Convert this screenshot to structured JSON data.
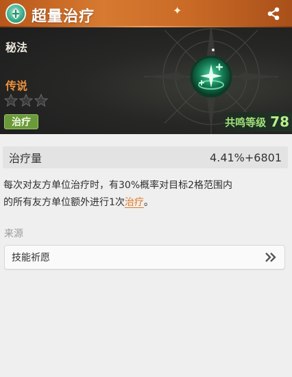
{
  "header": {
    "title": "超量治疗",
    "icon": "heal-emblem-icon",
    "share_icon": "share-icon",
    "accent": "#c96a26"
  },
  "banner": {
    "category": "秘法",
    "rarity": "传说",
    "rarity_color": "#f0913a",
    "stars_total": 3,
    "stars_filled": 0,
    "type_tag": "治疗",
    "type_tag_color": "#6a9a3a",
    "skill_icon": "healing-sparkle-orb-icon",
    "resonance_label": "共鸣等级",
    "resonance_value": "78",
    "resonance_color": "#9fe27a"
  },
  "stat": {
    "label": "治疗量",
    "value": "4.41%+6801"
  },
  "description": {
    "line1": "每次对友方单位治疗时，有30%概率对目标2格范围内",
    "line2_prefix": "的所有友方单位额外进行1次",
    "keyword": "治疗",
    "line2_suffix": "。",
    "keyword_color": "#e07820"
  },
  "source": {
    "label": "来源",
    "item": "技能祈愿",
    "chevron_icon": "double-chevron-right-icon"
  }
}
